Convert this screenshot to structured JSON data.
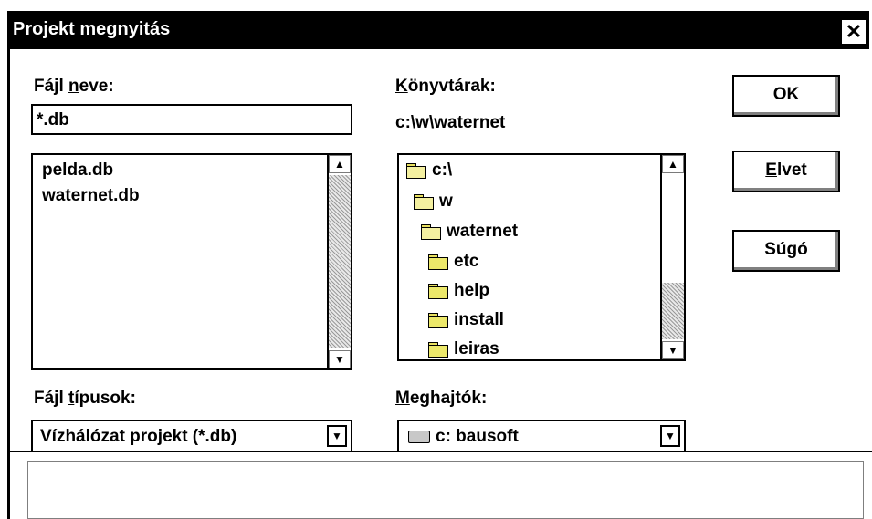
{
  "window": {
    "title": "Projekt megnyitás",
    "close_glyph": "✕"
  },
  "filename": {
    "label_pre": "Fájl ",
    "label_ul": "n",
    "label_post": "eve:",
    "value": "*.db"
  },
  "files": {
    "items": [
      "pelda.db",
      "waternet.db"
    ]
  },
  "directories": {
    "label_ul": "K",
    "label_post": "önyvtárak:",
    "current_path": "c:\\w\\waternet",
    "items": [
      "c:\\",
      "w",
      "waternet",
      "etc",
      "help",
      "install",
      "leiras"
    ]
  },
  "filetypes": {
    "label_pre": "Fájl ",
    "label_ul": "t",
    "label_post": "ípusok:",
    "selected": "Vízhálózat projekt (*.db)"
  },
  "drives": {
    "label_ul": "M",
    "label_post": "eghajtók:",
    "selected": "c: bausoft",
    "icon": "drive-icon"
  },
  "buttons": {
    "ok": "OK",
    "cancel_ul": "E",
    "cancel_post": "lvet",
    "help": "Súgó"
  },
  "icons": {
    "folder": "folder-icon",
    "scroll_up": "▲",
    "scroll_down": "▼"
  },
  "colors": {
    "titlebar": "#000000",
    "folder_fill": "#ece86a",
    "background": "#ffffff"
  }
}
